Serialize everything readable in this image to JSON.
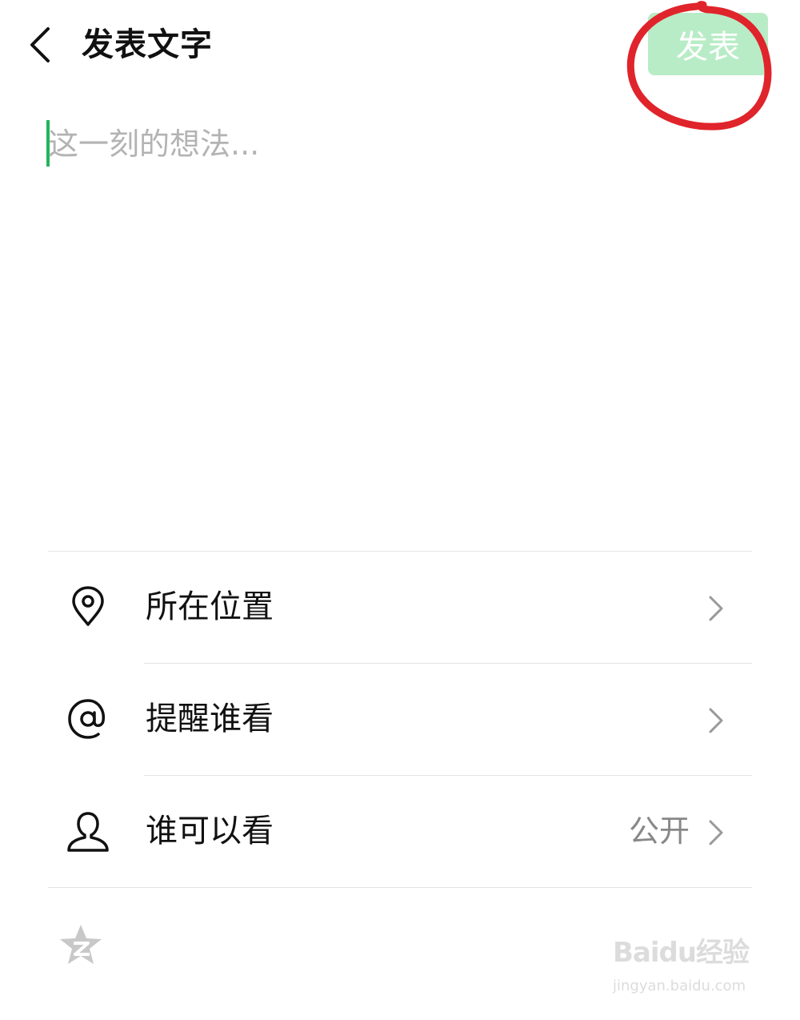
{
  "header": {
    "title": "发表文字",
    "publish_label": "发表"
  },
  "composer": {
    "placeholder": "这一刻的想法..."
  },
  "options": [
    {
      "label": "所在位置",
      "icon": "location-pin-icon",
      "value": ""
    },
    {
      "label": "提醒谁看",
      "icon": "at-sign-icon",
      "value": ""
    },
    {
      "label": "谁可以看",
      "icon": "person-icon",
      "value": "公开"
    }
  ],
  "watermark": {
    "main": "Baidu经验",
    "sub": "jingyan.baidu.com"
  },
  "colors": {
    "publish_disabled_bg": "#b8ecc6",
    "cursor": "#22b55a",
    "annotation_red": "#e0242b",
    "qzone_star": "#c8c8c8"
  }
}
